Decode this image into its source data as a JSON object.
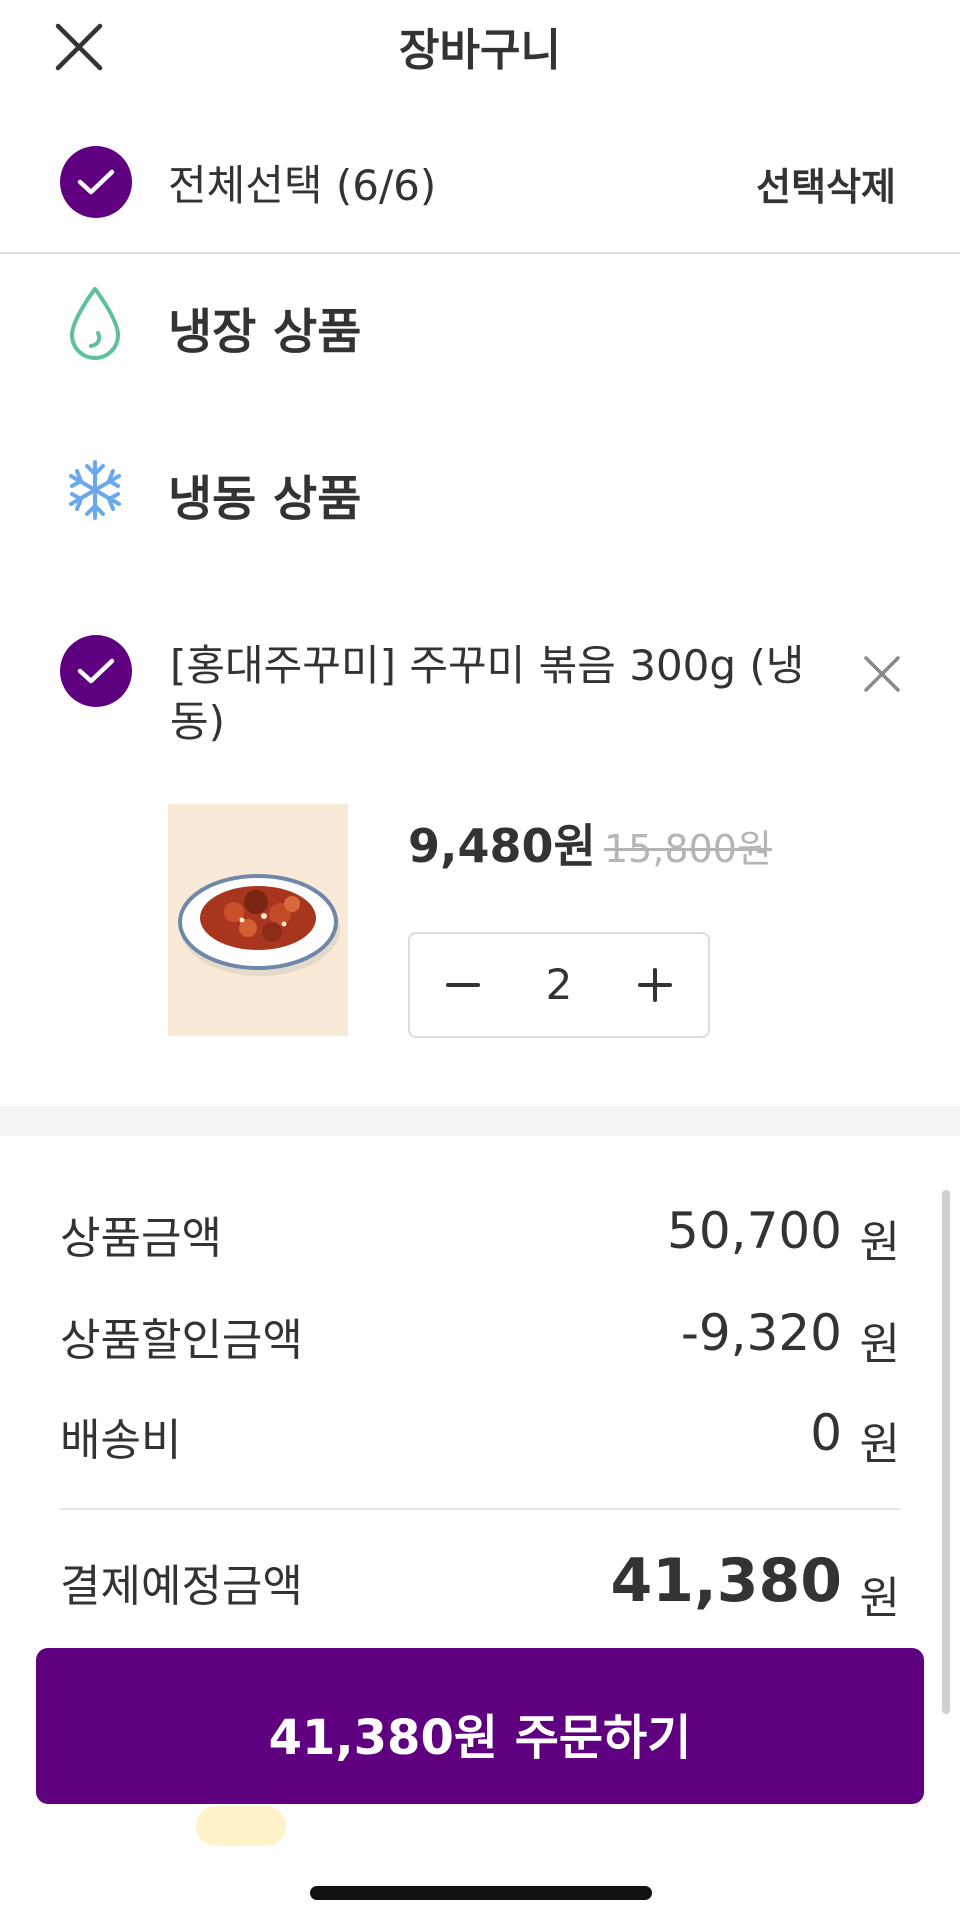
{
  "header": {
    "title": "장바구니",
    "close_icon": "close-icon"
  },
  "select_all": {
    "label": "전체선택 (6/6)",
    "delete_label": "선택삭제",
    "checked": true
  },
  "sections": {
    "fridge": {
      "title": "냉장 상품",
      "icon": "water-drop-icon",
      "icon_color": "#5fbf9f"
    },
    "frozen": {
      "title": "냉동 상품",
      "icon": "snowflake-icon",
      "icon_color": "#6aa8ee"
    }
  },
  "item": {
    "name": "[홍대주꾸미] 주꾸미 볶음 300g (냉동)",
    "price": "9,480원",
    "original_price": "15,800원",
    "quantity": "2",
    "checked": true
  },
  "summary": {
    "subtotal_label": "상품금액",
    "subtotal_value": "50,700",
    "discount_label": "상품할인금액",
    "discount_value": "-9,320",
    "shipping_label": "배송비",
    "shipping_value": "0",
    "total_label": "결제예정금액",
    "total_value": "41,380",
    "unit": "원"
  },
  "order_button": {
    "label": "41,380원 주문하기"
  },
  "colors": {
    "brand": "#5f0080",
    "text": "#333333",
    "muted": "#b5b5b5"
  }
}
